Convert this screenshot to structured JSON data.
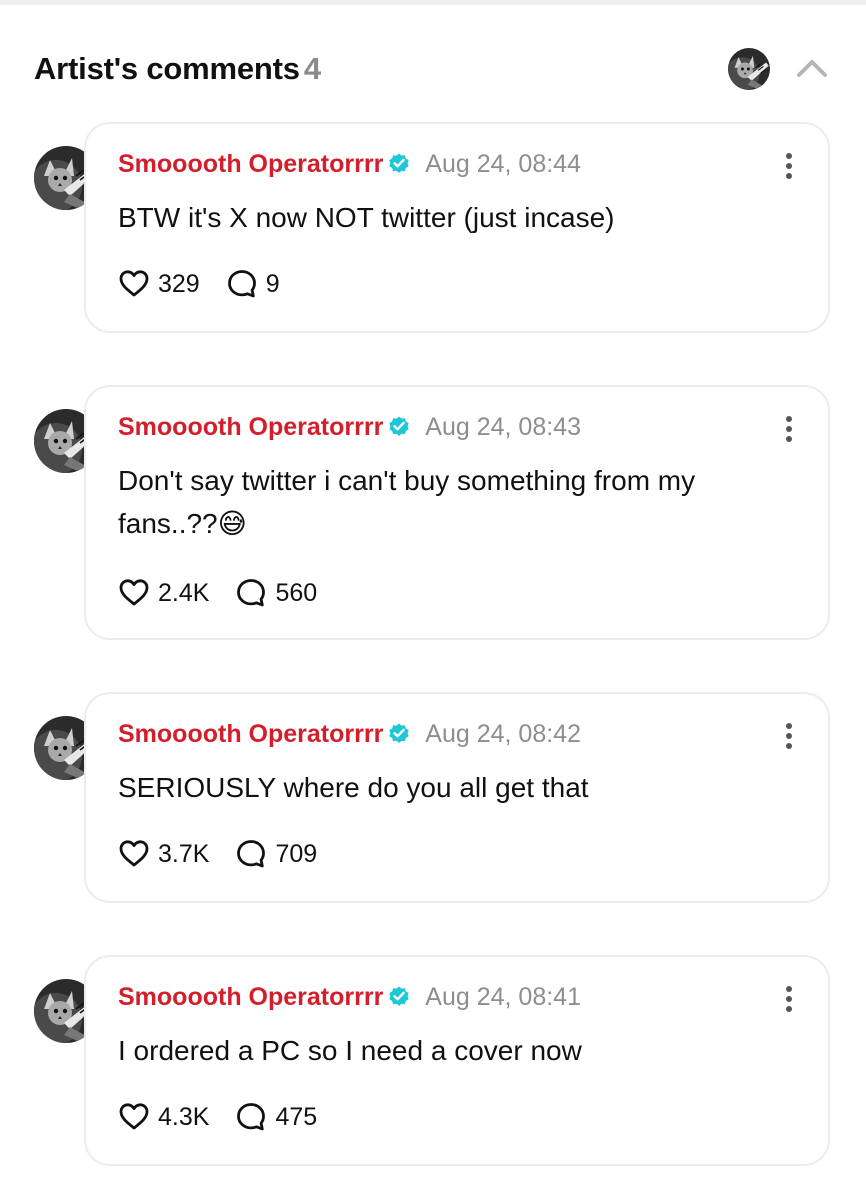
{
  "header": {
    "title": "Artist's comments",
    "count": "4"
  },
  "colors": {
    "author": "#d21f2b",
    "verified": "#1fc7d6",
    "date": "#8e8e8e",
    "card_border": "#ececec"
  },
  "icons": {
    "verified": "verified-badge-icon",
    "like": "heart-icon",
    "reply": "speech-bubble-icon",
    "more": "vertical-ellipsis-icon",
    "collapse": "chevron-up-icon"
  },
  "comments": [
    {
      "author": "Smooooth Operatorrrr",
      "date": "Aug 24, 08:44",
      "text": "BTW it's X now NOT twitter (just incase)",
      "likes": "329",
      "replies": "9"
    },
    {
      "author": "Smooooth Operatorrrr",
      "date": "Aug 24, 08:43",
      "text": "Don't say twitter i can't buy something from my fans..??😅",
      "likes": "2.4K",
      "replies": "560"
    },
    {
      "author": "Smooooth Operatorrrr",
      "date": "Aug 24, 08:42",
      "text": "SERIOUSLY where do you all get that",
      "likes": "3.7K",
      "replies": "709"
    },
    {
      "author": "Smooooth Operatorrrr",
      "date": "Aug 24, 08:41",
      "text": "I ordered a PC so I need a cover now",
      "likes": "4.3K",
      "replies": "475"
    }
  ]
}
